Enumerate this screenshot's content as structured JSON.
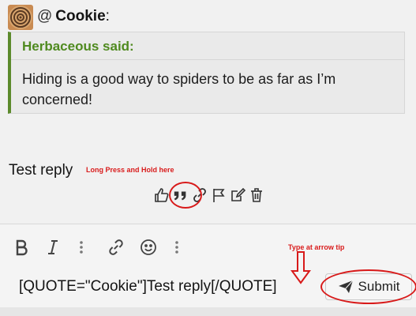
{
  "mention": {
    "at": "@",
    "name": "Cookie",
    "suffix": ":"
  },
  "quote": {
    "header": "Herbaceous said:",
    "body": "Hiding is a good way to spiders to be as far as I’m concerned!"
  },
  "post": {
    "text": "Test reply"
  },
  "annotations": {
    "long_press": "Long Press and Hold here",
    "type_arrow": "Type at arrow tip"
  },
  "actions": [
    "like-icon",
    "quote-icon",
    "link-icon",
    "flag-icon",
    "edit-icon",
    "delete-icon"
  ],
  "toolbar": [
    "bold-icon",
    "italic-icon",
    "more-icon",
    "link-icon",
    "smiley-icon",
    "more-icon"
  ],
  "editor": {
    "content": "[QUOTE=\"Cookie\"]Test reply[/QUOTE]"
  },
  "submit": {
    "label": "Submit"
  },
  "colors": {
    "quote_accent": "#5c8a2c",
    "quote_header": "#4f8a1f",
    "annotation": "#d91b1b"
  }
}
